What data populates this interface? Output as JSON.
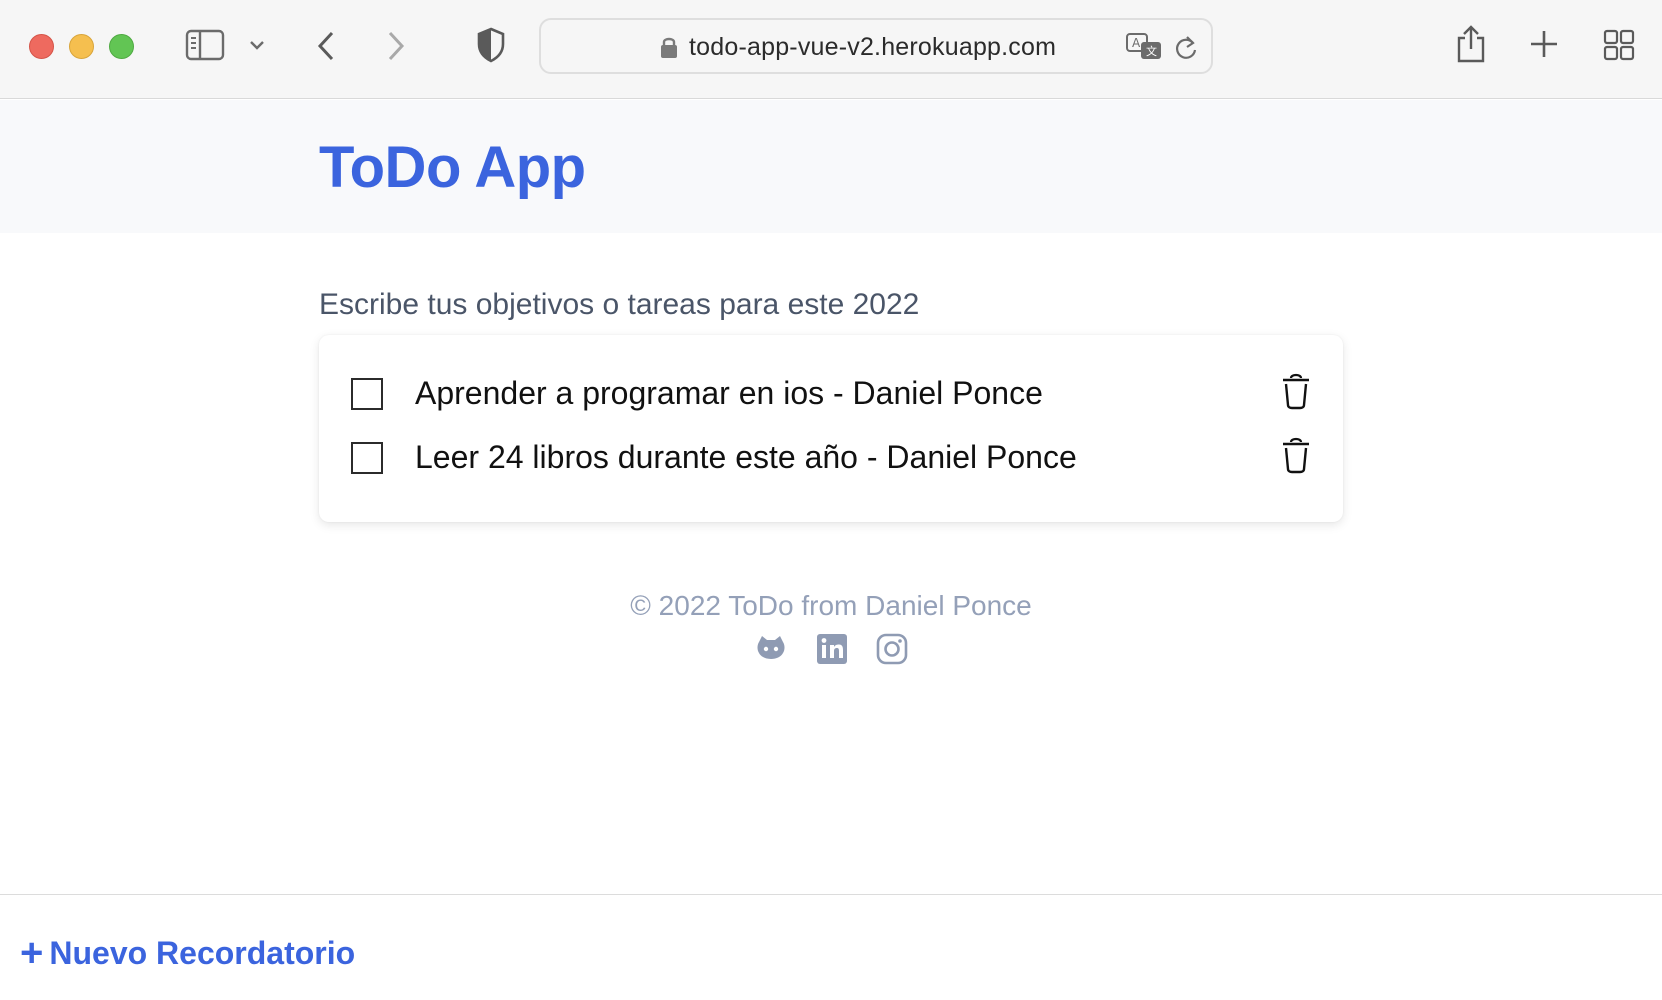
{
  "browser": {
    "url": "todo-app-vue-v2.herokuapp.com",
    "icons": [
      "close-window",
      "minimize-window",
      "maximize-window",
      "sidebar-icon",
      "chevron-down-icon",
      "back-icon",
      "forward-icon",
      "shield-icon",
      "lock-icon",
      "translate-icon",
      "reload-icon",
      "share-icon",
      "plus-icon",
      "tabs-grid-icon"
    ]
  },
  "app": {
    "title": "ToDo App",
    "accent_color": "#3b64de",
    "subtitle": "Escribe tus objetivos o tareas para este 2022"
  },
  "todos": [
    {
      "text": "Aprender a programar en ios - Daniel Ponce",
      "checked": false
    },
    {
      "text": "Leer 24 libros durante este año - Daniel Ponce",
      "checked": false
    }
  ],
  "footer": {
    "copyright": "© 2022 ToDo from Daniel Ponce",
    "social": [
      "github-icon",
      "linkedin-icon",
      "instagram-icon"
    ]
  },
  "bottom": {
    "plus": "+",
    "new_label": "Nuevo Recordatorio"
  }
}
